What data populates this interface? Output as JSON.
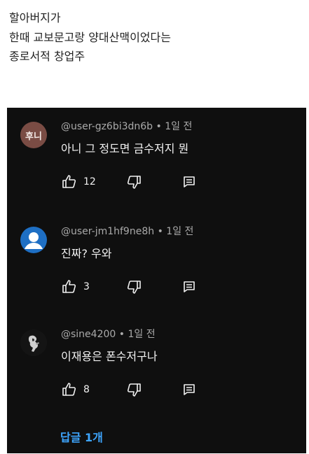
{
  "post": {
    "lines": [
      "할아버지가",
      "한때 교보문고랑 양대산맥이었다는",
      "종로서적 창업주"
    ]
  },
  "comments": [
    {
      "avatar_text": "후니",
      "author": "@user-gz6bi3dn6b",
      "time": "1일 전",
      "text": "아니 그 정도면 금수저지 뭔",
      "likes": "12"
    },
    {
      "avatar_icon": "default-user-icon",
      "author": "@user-jm1hf9ne8h",
      "time": "1일 전",
      "text": "진짜? 우와",
      "likes": "3"
    },
    {
      "avatar_icon": "photo-avatar",
      "author": "@sine4200",
      "time": "1일 전",
      "text": "이재용은 폰수저구나",
      "likes": "8"
    }
  ],
  "separator": "•",
  "replies_label": "답글 1개",
  "colors": {
    "panel_bg": "#0f0f0f",
    "accent_blue": "#3ea6ff",
    "meta_gray": "#aaaaaa"
  }
}
